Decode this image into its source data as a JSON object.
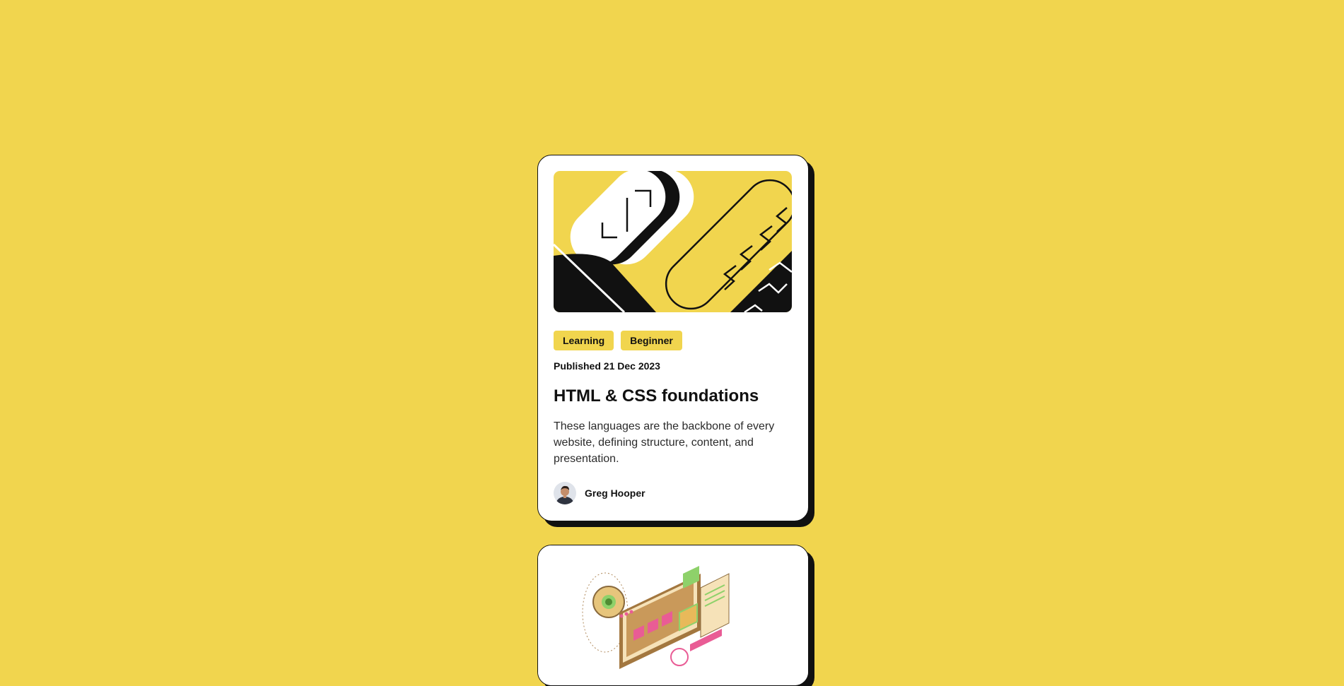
{
  "colors": {
    "background": "#F1D54E",
    "card": "#FFFFFF",
    "ink": "#111111",
    "tag_bg": "#F1D54E"
  },
  "card": {
    "image_icon": "html-css-illustration",
    "tags": [
      "Learning",
      "Beginner"
    ],
    "published": "Published 21 Dec 2023",
    "title": "HTML & CSS foundations",
    "description": "These languages are the backbone of every website, defining structure, content, and presentation.",
    "author": {
      "name": "Greg Hooper",
      "avatar_icon": "author-avatar"
    }
  },
  "second_card": {
    "image_icon": "isometric-web-illustration"
  }
}
